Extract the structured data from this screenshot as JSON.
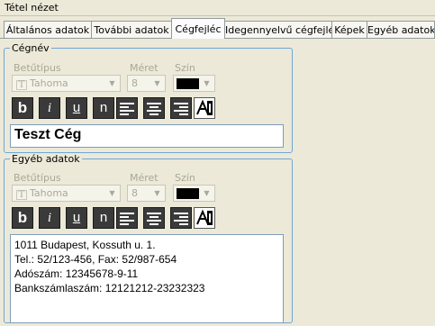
{
  "window": {
    "title": "Tétel nézet"
  },
  "tabs": [
    {
      "label": "Általános adatok"
    },
    {
      "label": "További adatok"
    },
    {
      "label": "Cégfejléc"
    },
    {
      "label": "Idegennyelvű cégfejléc"
    },
    {
      "label": "Képek"
    },
    {
      "label": "Egyéb adatok"
    }
  ],
  "active_tab": "Cégfejléc",
  "company_name_group": {
    "legend": "Cégnév",
    "font_label": "Betűtípus",
    "font_value": "Tahoma",
    "size_label": "Méret",
    "size_value": "8",
    "color_label": "Szín",
    "color_value": "#000000",
    "name_value": "Teszt Cég"
  },
  "other_data_group": {
    "legend": "Egyéb adatok",
    "font_label": "Betűtípus",
    "font_value": "Tahoma",
    "size_label": "Méret",
    "size_value": "8",
    "color_label": "Szín",
    "color_value": "#000000",
    "lines": [
      "1011 Budapest, Kossuth u. 1.",
      "Tel.: 52/123-456, Fax: 52/987-654",
      "Adószám: 12345678-9-11",
      "Bankszámlaszám: 12121212-23232323"
    ]
  },
  "format_buttons": {
    "bold": "b",
    "italic": "i",
    "underline": "u",
    "normal": "n",
    "icons": [
      "bold-icon",
      "italic-icon",
      "underline-icon",
      "normal-icon",
      "align-left-icon",
      "align-center-icon",
      "align-right-icon",
      "text-color-icon"
    ]
  }
}
